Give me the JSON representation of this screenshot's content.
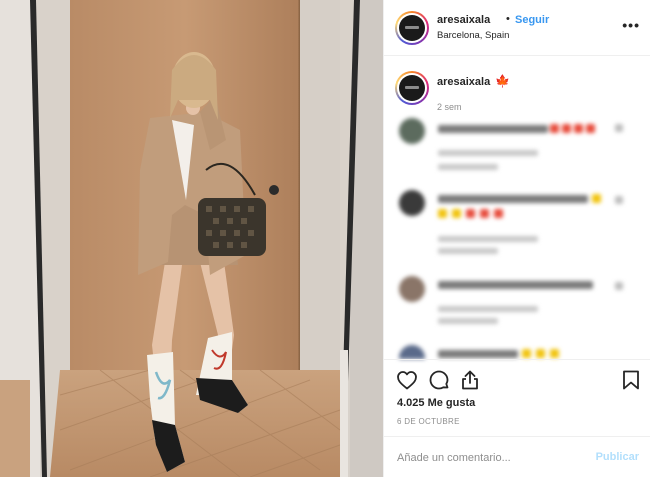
{
  "post": {
    "username": "aresaixala",
    "follow_separator": "•",
    "follow_label": "Seguir",
    "location": "Barcelona, Spain",
    "more_label": "•••"
  },
  "caption": {
    "username": "aresaixala",
    "emoji": "🍁",
    "time_ago": "2 sem"
  },
  "footer": {
    "likes_text": "4.025 Me gusta",
    "date_text": "6 DE OCTUBRE",
    "comment_placeholder": "Añade un comentario...",
    "publish_label": "Publicar"
  },
  "icons": {
    "like": "heart-icon",
    "comment": "comment-bubble-icon",
    "share": "share-icon",
    "save": "bookmark-icon",
    "more": "more-options-icon"
  },
  "colors": {
    "link_blue": "#3897f0",
    "publish_disabled": "#b2dffc",
    "muted": "#8e8e8e",
    "text": "#262626"
  }
}
